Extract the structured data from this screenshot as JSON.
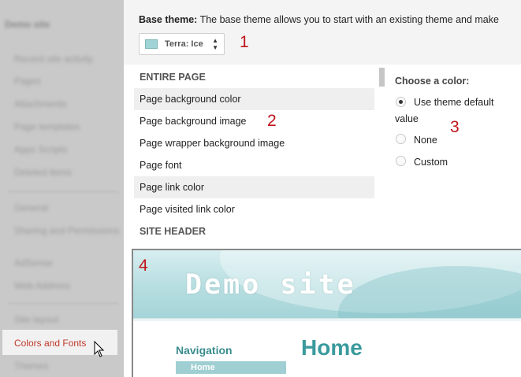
{
  "sidebar": {
    "header": "Demo site",
    "items": [
      "Recent site activity",
      "Pages",
      "Attachments",
      "Page templates",
      "Apps Scripts",
      "Deleted items",
      "General",
      "Sharing and Permissions",
      "AdSense",
      "Web Address",
      "Site layout"
    ],
    "selected": "Colors and Fonts",
    "after_selected": "Themes"
  },
  "base_theme": {
    "label": "Base theme:",
    "description": "The base theme allows you to start with an existing theme and make",
    "selected_theme": "Terra: Ice"
  },
  "markers": [
    "1",
    "2",
    "3",
    "4"
  ],
  "list": {
    "section1": "ENTIRE PAGE",
    "items": [
      "Page background color",
      "Page background image",
      "Page wrapper background image",
      "Page font",
      "Page link color",
      "Page visited link color"
    ],
    "section2": "SITE HEADER"
  },
  "chooser": {
    "title": "Choose a color:",
    "option_default_1": "Use theme default",
    "option_default_2": "value",
    "option_none": "None",
    "option_custom": "Custom"
  },
  "preview": {
    "site_title": "Demo site",
    "nav_title": "Navigation",
    "nav_item": "Home",
    "page_title": "Home"
  },
  "colors": {
    "accent_red": "#c0141b",
    "teal": "#3a9a9d"
  }
}
